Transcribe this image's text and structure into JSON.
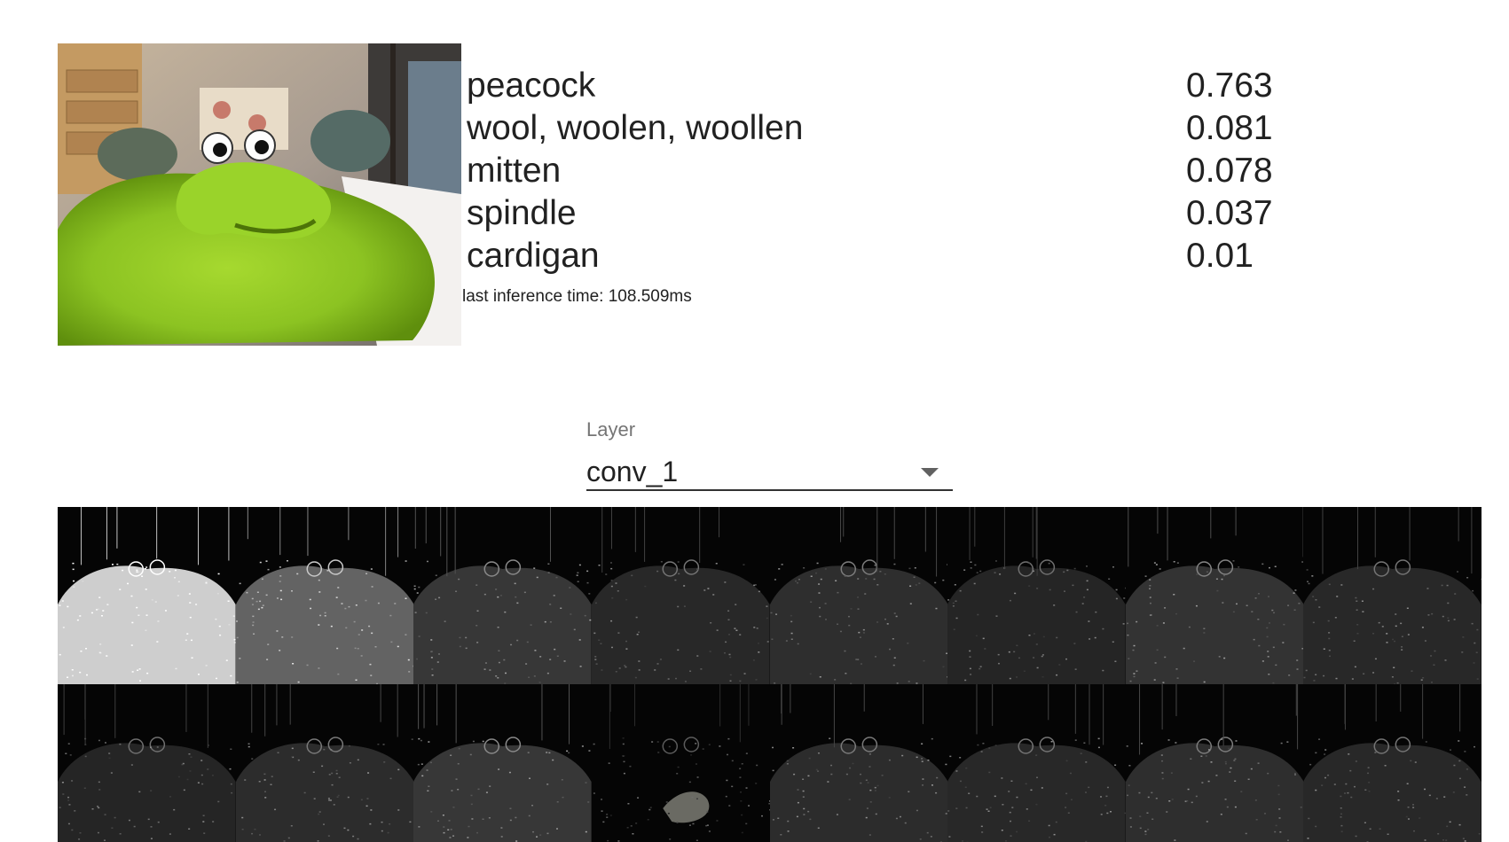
{
  "webcam": {
    "alt": "webcam frame"
  },
  "predictions": [
    {
      "label": "peacock",
      "score": "0.763"
    },
    {
      "label": "wool, woolen, woollen",
      "score": "0.081"
    },
    {
      "label": "mitten",
      "score": "0.078"
    },
    {
      "label": "spindle",
      "score": "0.037"
    },
    {
      "label": "cardigan",
      "score": "0.01"
    }
  ],
  "inference_text": "last inference time: 108.509ms",
  "layer_select": {
    "caption": "Layer",
    "value": "conv_1"
  },
  "activations": {
    "count": 16,
    "brightness": [
      0.85,
      0.55,
      0.3,
      0.22,
      0.25,
      0.2,
      0.28,
      0.22,
      0.2,
      0.24,
      0.3,
      0.12,
      0.24,
      0.22,
      0.25,
      0.22
    ]
  },
  "colors": {
    "plush_green": "#8fc824",
    "plush_shadow": "#6a9a10",
    "background_wall": "#b5aaa0"
  }
}
